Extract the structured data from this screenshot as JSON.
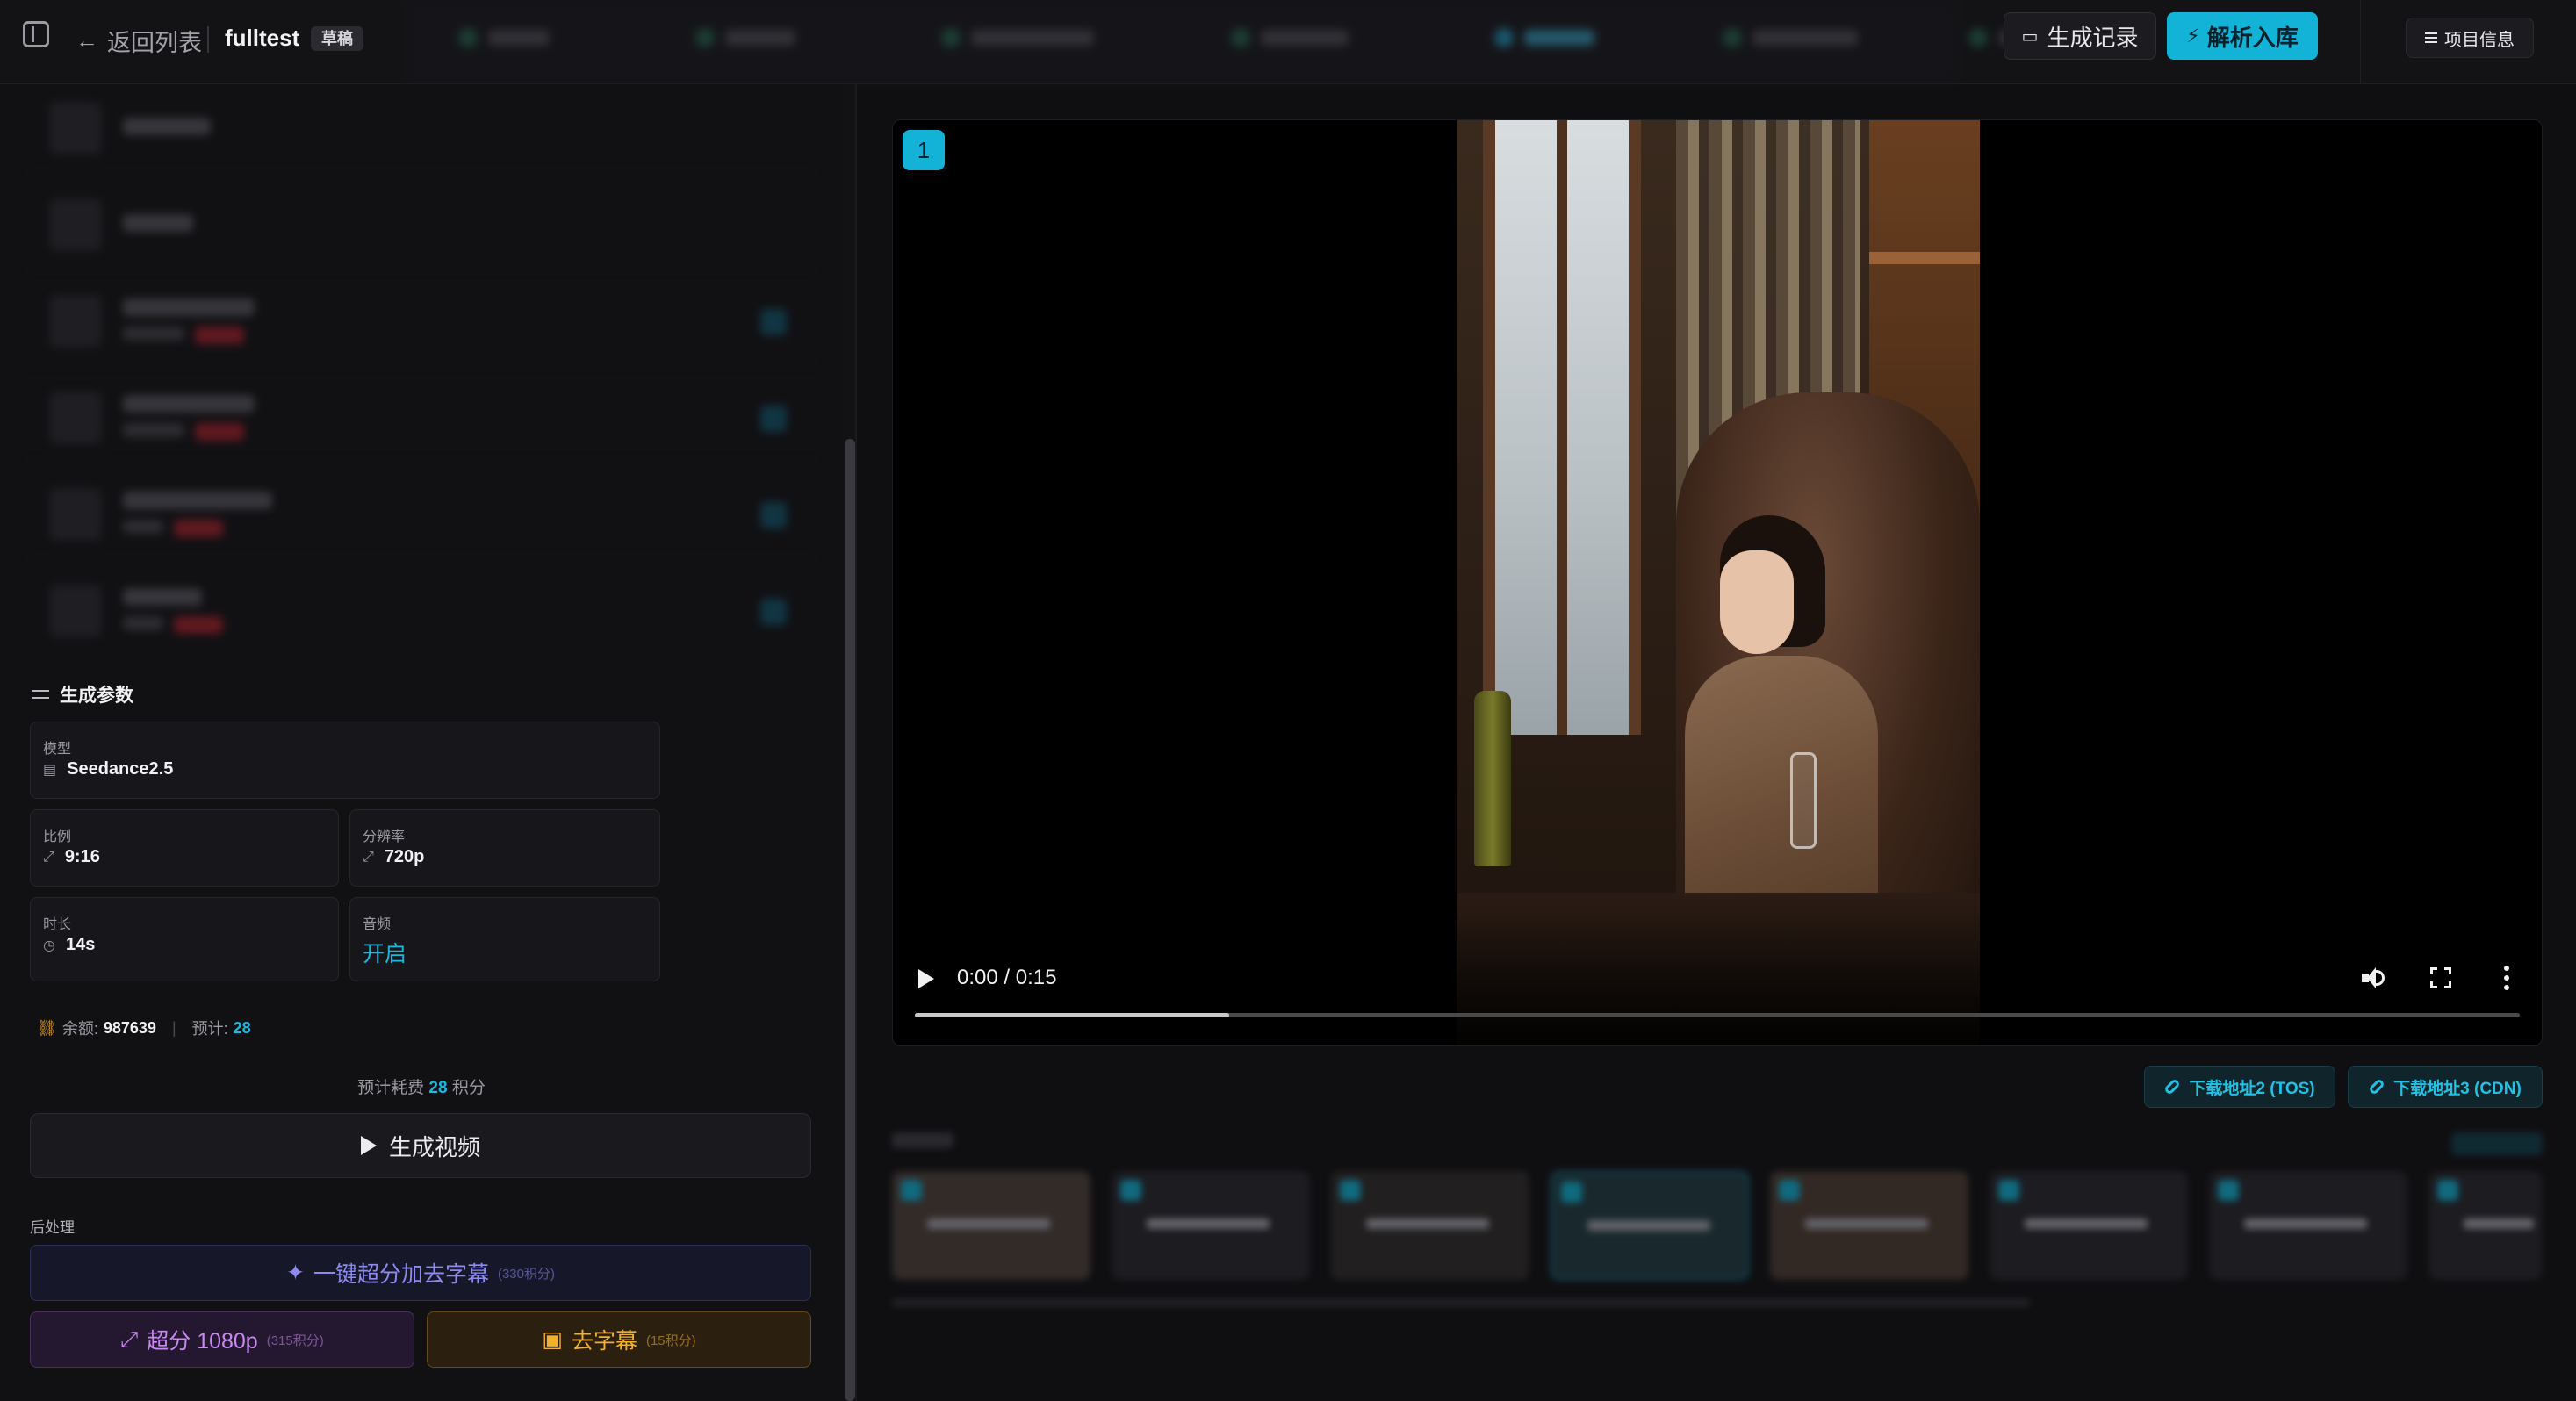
{
  "topbar": {
    "back_label": "返回列表",
    "project_name": "fulltest",
    "status_badge": "草稿",
    "history_button": "生成记录",
    "parse_button": "解析入库",
    "info_button": "项目信息"
  },
  "params": {
    "section_title": "生成参数",
    "model_label": "模型",
    "model_value": "Seedance2.5",
    "ratio_label": "比例",
    "ratio_value": "9:16",
    "resolution_label": "分辨率",
    "resolution_value": "720p",
    "duration_label": "时长",
    "duration_value": "14s",
    "audio_label": "音频",
    "audio_value": "开启"
  },
  "balance": {
    "balance_label": "余额:",
    "balance_value": "987639",
    "estimate_label": "预计:",
    "estimate_value": "28"
  },
  "cost": {
    "prefix": "预计耗费",
    "value": "28",
    "suffix": "积分"
  },
  "generate_button": "生成视频",
  "postprocess": {
    "title": "后处理",
    "combo_label": "一键超分加去字幕",
    "combo_cost": "(330积分)",
    "upscale_label": "超分 1080p",
    "upscale_cost": "(315积分)",
    "subtitle_label": "去字幕",
    "subtitle_cost": "(15积分)"
  },
  "video": {
    "index_badge": "1",
    "time_display": "0:00 / 0:15",
    "progress": 0.196
  },
  "downloads": {
    "tos_label": "下载地址2 (TOS)",
    "cdn_label": "下载地址3 (CDN)"
  },
  "colors": {
    "accent": "#12b3d6",
    "upscale": "#c88af0",
    "subtitle": "#f0b030",
    "combo": "#8c8cf0"
  }
}
